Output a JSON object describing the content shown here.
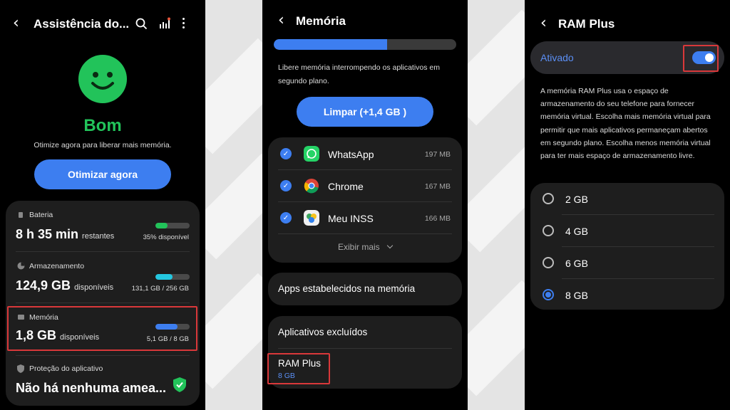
{
  "colors": {
    "accent": "#3d7ef0",
    "good_green": "#22c35a",
    "highlight_red": "#d9383a",
    "storage_cyan": "#24c7e0"
  },
  "panel1": {
    "title": "Assistência do...",
    "status": "Bom",
    "subtitle": "Otimize agora para liberar mais memória.",
    "optimize_button": "Otimizar agora",
    "battery": {
      "label": "Bateria",
      "value": "8 h 35 min",
      "suffix": "restantes",
      "detail": "35% disponível",
      "fraction": 0.35
    },
    "storage": {
      "label": "Armazenamento",
      "value": "124,9 GB",
      "suffix": "disponíveis",
      "detail": "131,1 GB / 256 GB",
      "fraction": 0.51
    },
    "memory": {
      "label": "Memória",
      "value": "1,8 GB",
      "suffix": "disponíveis",
      "detail": "5,1 GB / 8 GB",
      "fraction": 0.64
    },
    "protection": {
      "label": "Proteção do aplicativo",
      "value": "Não há nenhuma amea..."
    }
  },
  "panel2": {
    "title": "Memória",
    "usage_fraction": 0.62,
    "description": "Libere memória interrompendo os aplicativos em segundo plano.",
    "clean_button": "Limpar (+1,4 GB )",
    "apps": [
      {
        "name": "WhatsApp",
        "size": "197 MB"
      },
      {
        "name": "Chrome",
        "size": "167 MB"
      },
      {
        "name": "Meu INSS",
        "size": "166 MB"
      }
    ],
    "show_more": "Exibir mais",
    "apps_in_memory": "Apps estabelecidos na memória",
    "excluded_apps": "Aplicativos excluídos",
    "ram_plus": {
      "label": "RAM Plus",
      "value": "8 GB"
    }
  },
  "panel3": {
    "title": "RAM Plus",
    "toggle_label": "Ativado",
    "toggle_on": true,
    "description": "A memória RAM Plus usa o espaço de armazenamento do seu telefone para fornecer memória virtual. Escolha mais memória virtual para permitir que mais aplicativos permaneçam abertos em segundo plano. Escolha menos memória virtual para ter mais espaço de armazenamento livre.",
    "options": [
      "2 GB",
      "4 GB",
      "6 GB",
      "8 GB"
    ],
    "selected_option": "8 GB"
  }
}
